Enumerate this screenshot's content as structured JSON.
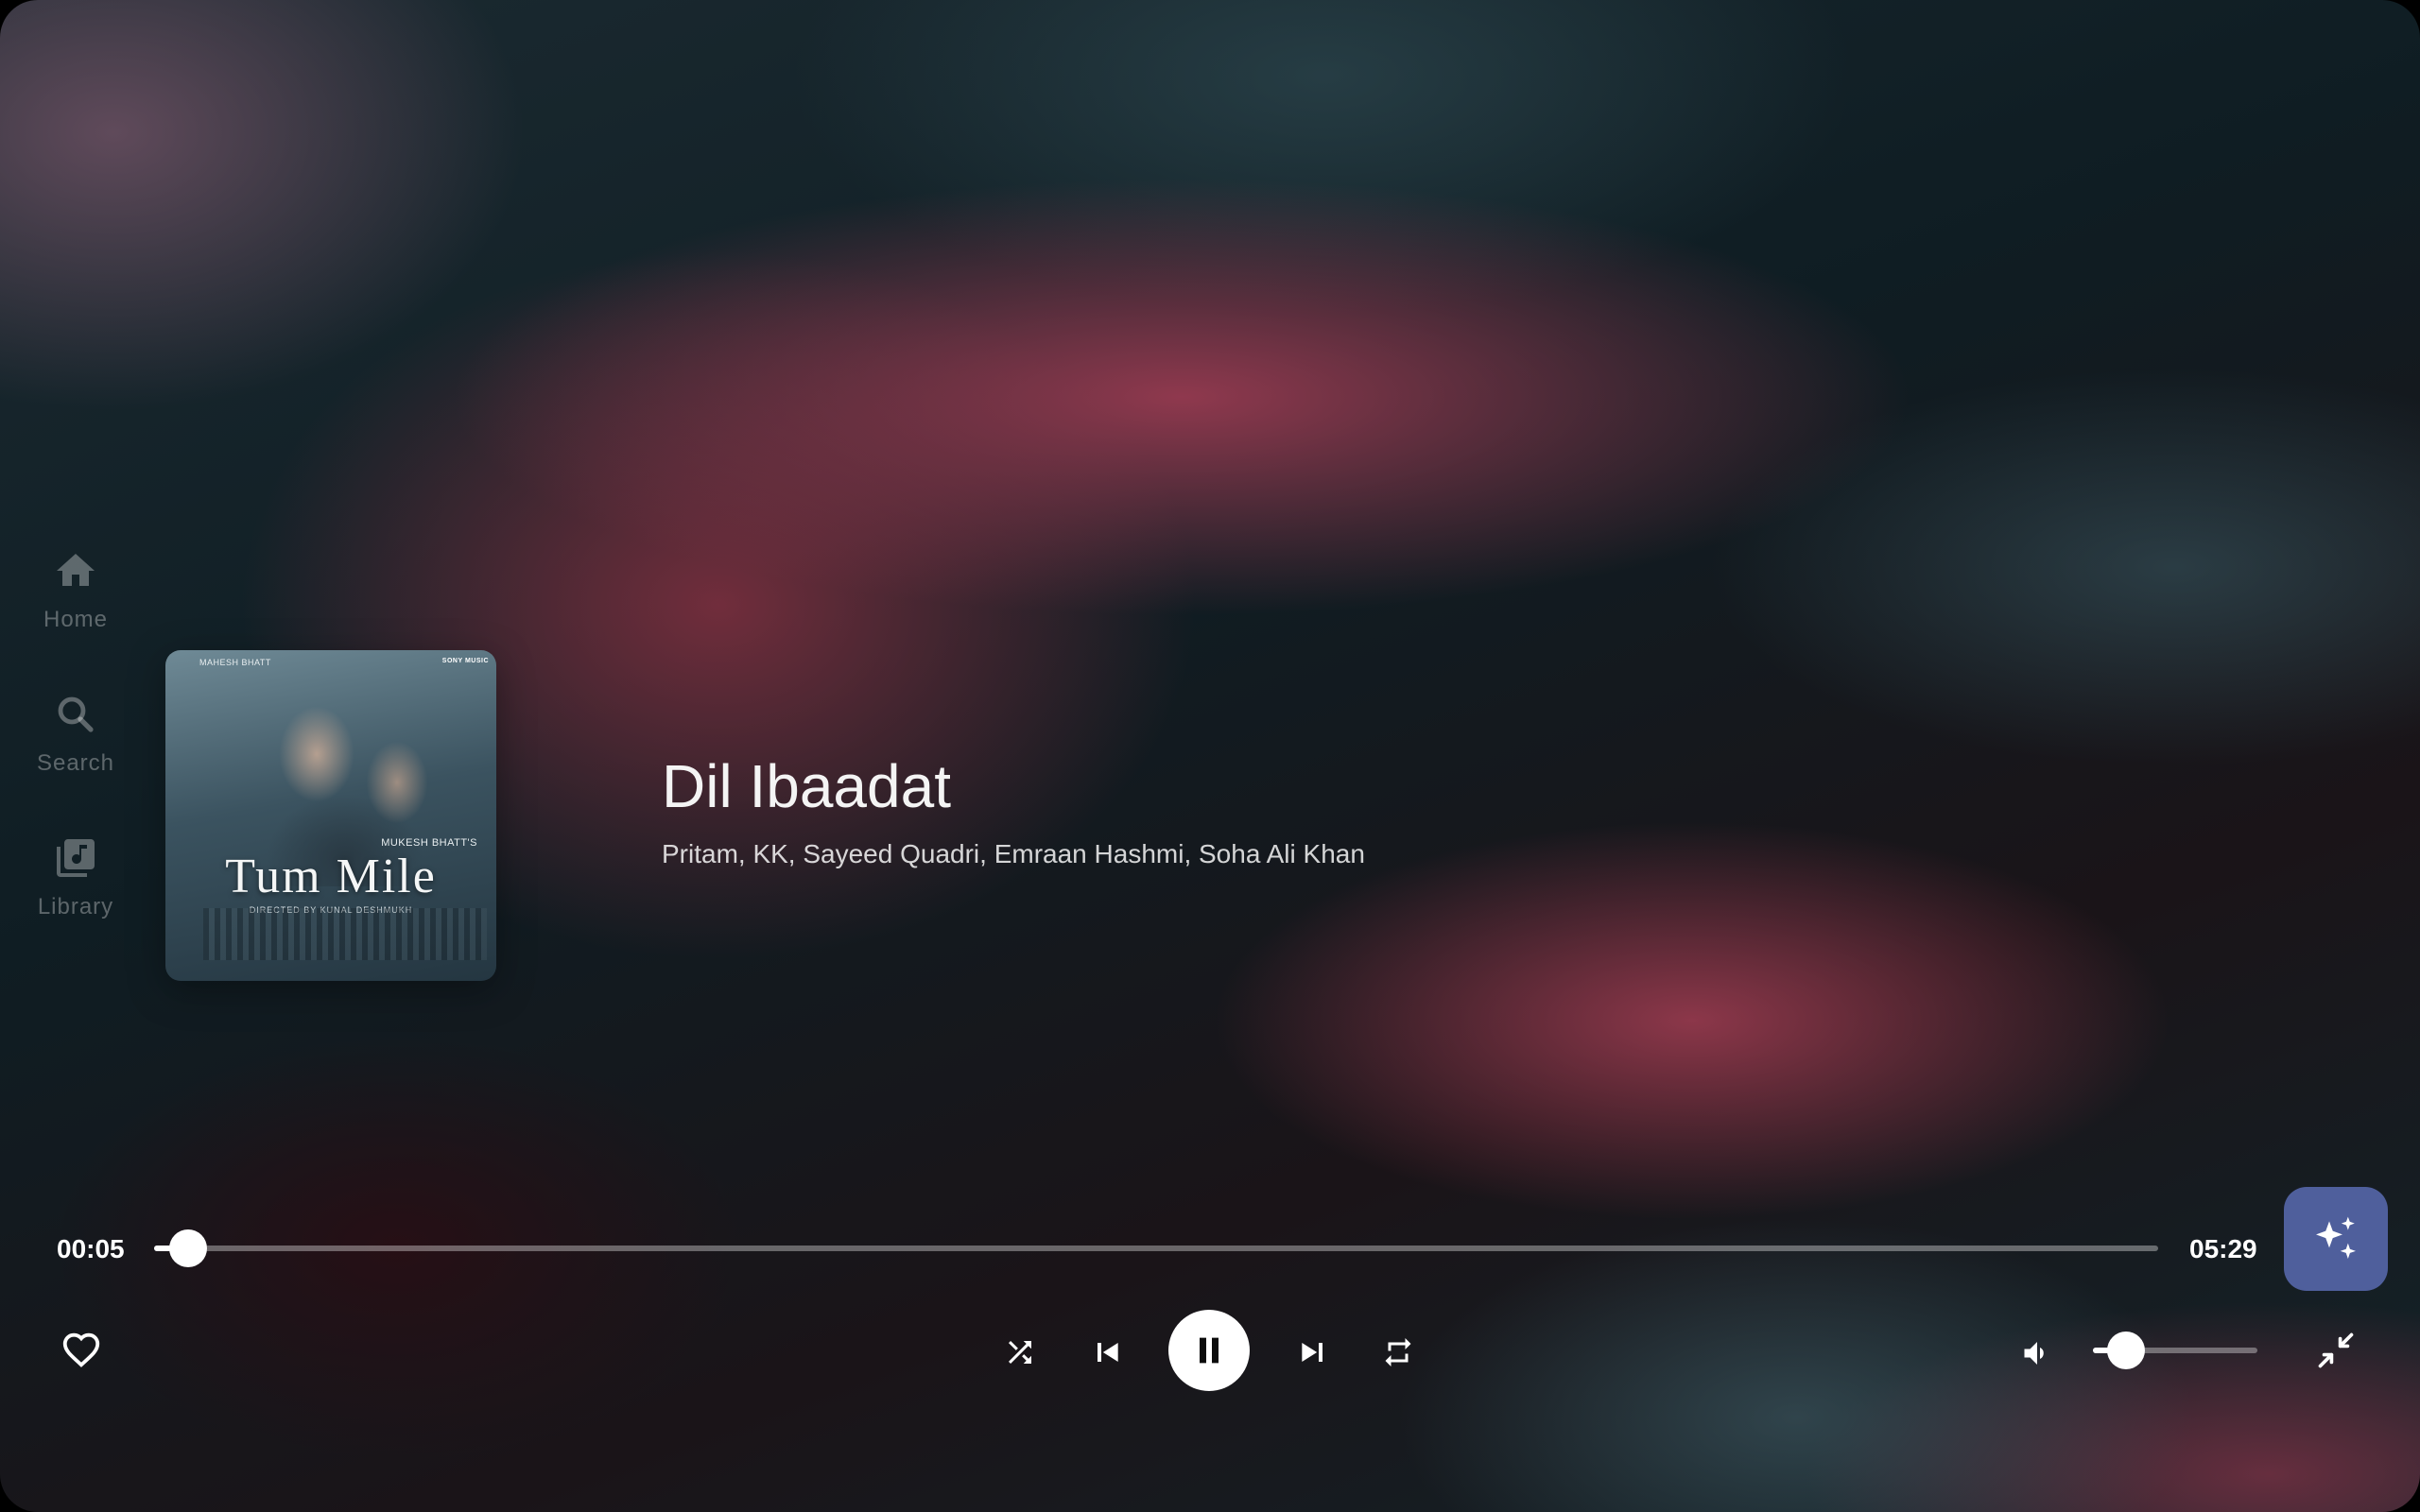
{
  "nav": {
    "items": [
      {
        "label": "Home",
        "icon": "home-icon"
      },
      {
        "label": "Search",
        "icon": "search-icon"
      },
      {
        "label": "Library",
        "icon": "library-music-icon"
      }
    ]
  },
  "album": {
    "title": "Tum Mile",
    "publisher": "MAHESH BHATT",
    "presenter_line": "MUKESH BHATT'S",
    "director_line": "DIRECTED BY KUNAL DESHMUKH",
    "label": "SONY MUSIC"
  },
  "track": {
    "title": "Dil Ibaadat",
    "artists": "Pritam, KK, Sayeed Quadri, Emraan Hashmi, Soha Ali Khan"
  },
  "playback": {
    "elapsed": "00:05",
    "total": "05:29",
    "progress_fraction": 0.017,
    "volume_fraction": 0.2,
    "state": "playing"
  },
  "icons": {
    "like": "heart-outline-icon",
    "shuffle": "shuffle-icon",
    "previous": "skip-previous-icon",
    "play_pause": "pause-icon",
    "next": "skip-next-icon",
    "repeat": "repeat-icon",
    "volume": "volume-down-icon",
    "minimize": "collapse-fullscreen-icon",
    "ai": "sparkles-icon"
  },
  "colors": {
    "accent_fab": "#4f5f9c",
    "nav_inactive": "rgba(255,255,255,0.32)"
  }
}
